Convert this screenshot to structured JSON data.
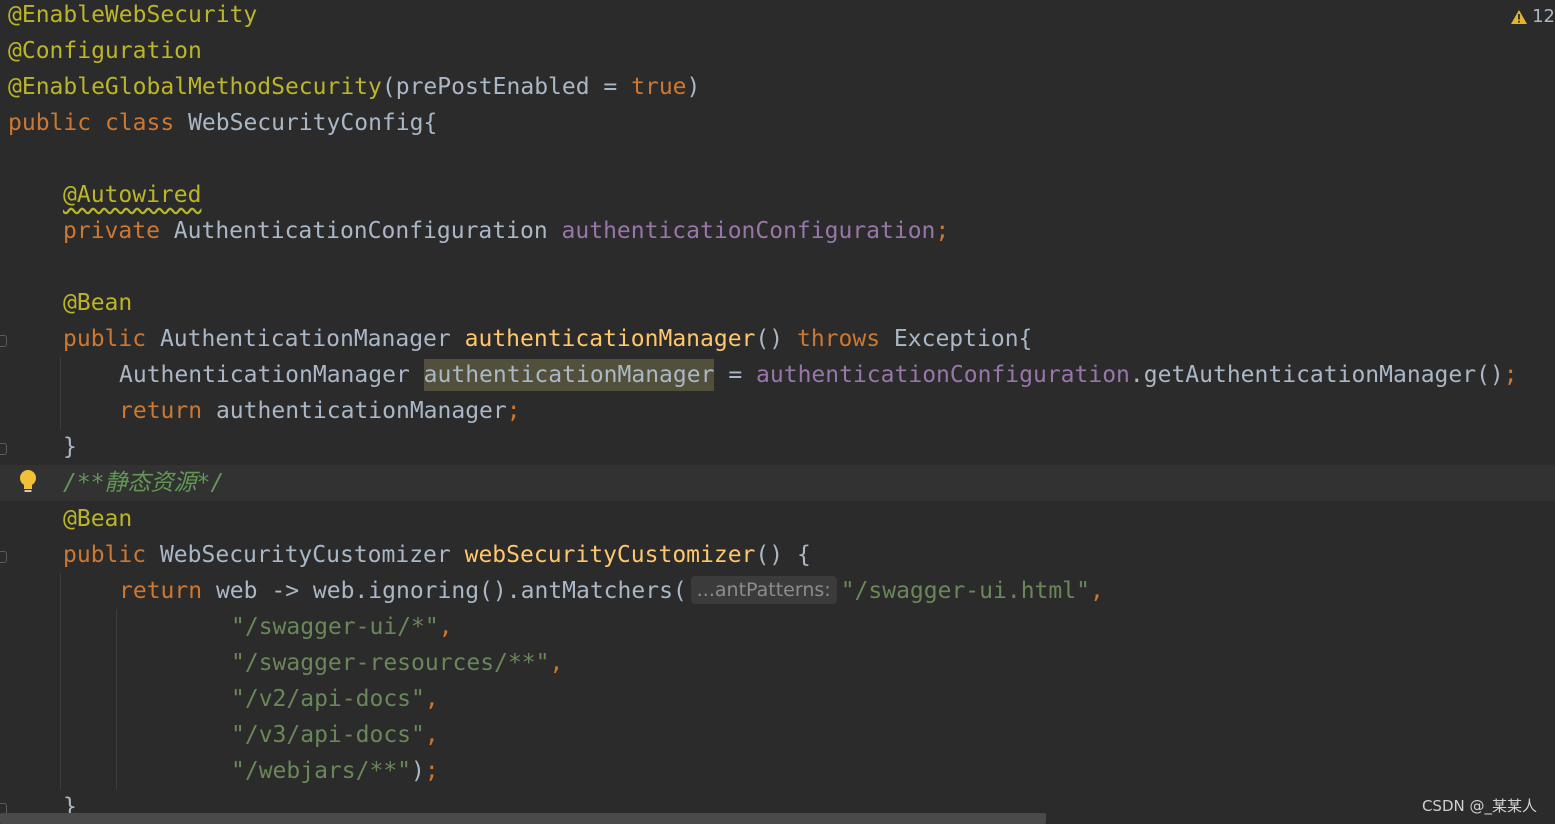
{
  "editor": {
    "warning_count": "12",
    "warning_icon": "warning-triangle-icon",
    "bulb_icon": "lightbulb-icon"
  },
  "code": {
    "l1": "@EnableWebSecurity",
    "l2": "@Configuration",
    "l3_ann": "@EnableGlobalMethodSecurity",
    "l3_paren": "(prePostEnabled = ",
    "l3_true": "true",
    "l3_close": ")",
    "l4_public": "public",
    "l4_class": "class",
    "l4_name": "WebSecurityConfig{",
    "l6_ann": "@Autowired",
    "l7_private": "private",
    "l7_type": "AuthenticationConfiguration",
    "l7_field": "authenticationConfiguration",
    "semi": ";",
    "l9_ann": "@Bean",
    "l10_public": "public",
    "l10_type": "AuthenticationManager",
    "l10_method": "authenticationManager",
    "l10_parens": "()",
    "l10_throws": "throws",
    "l10_exc": "Exception{",
    "l11_type": "AuthenticationManager",
    "l11_var": "authenticationManager",
    "l11_eq": "=",
    "l11_field": "authenticationConfiguration",
    "l11_call": ".getAuthenticationManager()",
    "l12_return": "return",
    "l12_var": "authenticationManager",
    "close_brace": "}",
    "l14_cmt_start": "/**",
    "l14_cmt_text": "静态资源",
    "l14_cmt_end": "*/",
    "l15_ann": "@Bean",
    "l16_public": "public",
    "l16_type": "WebSecurityCustomizer",
    "l16_method": "webSecurityCustomizer",
    "l16_rest": "() {",
    "l17_return": "return",
    "l17_lambda": "web -> web.ignoring().antMatchers(",
    "l17_hint": "...antPatterns:",
    "l17_str": "\"/swagger-ui.html\"",
    "comma": ",",
    "l18_str": "\"/swagger-ui/*\"",
    "l19_str": "\"/swagger-resources/**\"",
    "l20_str": "\"/v2/api-docs\"",
    "l21_str": "\"/v3/api-docs\"",
    "l22_str": "\"/webjars/**\"",
    "l22_close": ")"
  },
  "watermark": "CSDN @_某某人"
}
